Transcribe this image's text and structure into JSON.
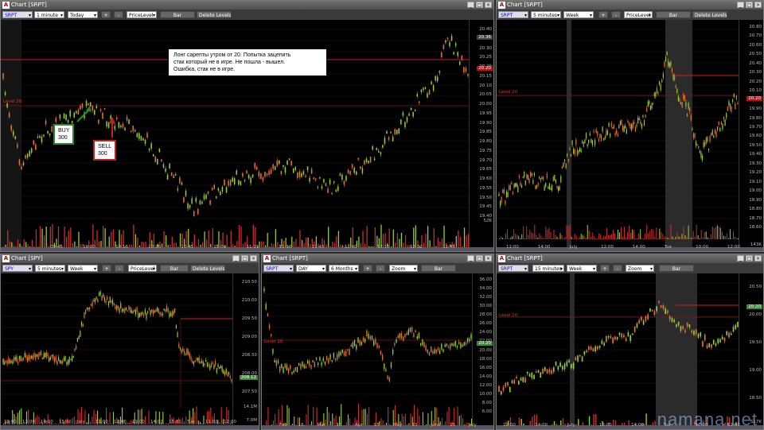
{
  "windows": {
    "w1": {
      "title": "Chart [SRPT]",
      "symbol": "SRPT",
      "interval": "1 minute",
      "range": "Today",
      "view": "PriceLevel",
      "bar": "Bar",
      "delete": "Delete Levels",
      "level_label": "Level 20",
      "yticks": [
        "20.40",
        "20.35",
        "20.30",
        "20.25",
        "20.20",
        "20.15",
        "20.10",
        "20.05",
        "20.00",
        "19.95",
        "19.90",
        "19.85",
        "19.80",
        "19.75",
        "19.70",
        "19.65",
        "19.60",
        "19.55",
        "19.50",
        "19.45",
        "19.40"
      ],
      "tag_top": "20.36",
      "tag_red": "20.20",
      "vol": "52K",
      "xticks": [
        "09:45",
        "10:00",
        "10:15",
        "10:30",
        "10:45",
        "11:00",
        "11:15",
        "11:30",
        "11:45",
        "12:00",
        "12:15",
        "12:32",
        "12:45"
      ],
      "note": "Лонг сарепты утром от 20. Попытка зацепить\nстак который не в игре. Не пошла - вышел.\nОшибка, стак не в игре.",
      "buy": "BUY\n300",
      "sell": "SELL\n300"
    },
    "w2": {
      "title": "Chart [SRPT]",
      "symbol": "SRPT",
      "interval": "5 minutes",
      "range": "Week",
      "view": "PriceLevel",
      "bar": "Bar",
      "delete": "Delete Levels",
      "level_label": "Level 20",
      "yticks": [
        "20.80",
        "20.70",
        "20.60",
        "20.50",
        "20.40",
        "20.30",
        "20.20",
        "20.10",
        "20.00",
        "19.90",
        "19.80",
        "19.70",
        "19.60",
        "19.50",
        "19.40",
        "19.30",
        "19.20",
        "19.10",
        "19.00",
        "18.90",
        "18.80",
        "18.70",
        "18.60"
      ],
      "tag_top": "20.20",
      "vol": "143K",
      "xticks": [
        "12:00",
        "14:00",
        "July",
        "12:00",
        "14:00",
        "Tue",
        "10:00",
        "12:00"
      ]
    },
    "w3": {
      "title": "Chart [SPY]",
      "symbol": "SPY",
      "interval": "5 minutes",
      "range": "Week",
      "view": "PriceLevel",
      "bar": "Bar",
      "delete": "Delete Levels",
      "level_label": "Level 207.91",
      "yticks": [
        "210.50",
        "210.00",
        "209.50",
        "209.00",
        "208.50",
        "208.00",
        "207.50"
      ],
      "tag_top": "208.12",
      "vol_top": "14.1M",
      "vol_mid": "7.0M",
      "xticks": [
        "12:00",
        "13:00",
        "14:00",
        "15:00",
        "July",
        "11:00",
        "12:00",
        "13:00",
        "14:00",
        "15:00",
        "Tue",
        "11:00",
        "12:00"
      ]
    },
    "w4": {
      "title": "Chart [SRPT]",
      "symbol": "SRPT",
      "interval": "DAY",
      "range": "6 Months",
      "view": "Zoom",
      "bar": "Bar",
      "level_label": "Level 20",
      "yticks": [
        "36.00",
        "34.00",
        "32.00",
        "30.00",
        "28.00",
        "26.00",
        "24.00",
        "22.00",
        "20.00",
        "18.00",
        "16.00",
        "14.00",
        "12.00",
        "10.00",
        "8.00",
        "6.00"
      ],
      "tag_top": "20.20",
      "xticks": [
        "Feb",
        "16",
        "Mar",
        "15",
        "Apr",
        "15",
        "May",
        "15",
        "June",
        "15",
        "July"
      ]
    },
    "w5": {
      "title": "Chart [SRPT]",
      "symbol": "SRPT",
      "interval": "15 minutes",
      "range": "Week",
      "view": "Zoom",
      "bar": "Bar",
      "level_label": "Level 20",
      "yticks": [
        "20.50",
        "20.00",
        "19.50",
        "19.00",
        "18.50"
      ],
      "tag_top": "20.20",
      "vol": "517K",
      "xticks": [
        "12:00",
        "14:00",
        "July",
        "12:00",
        "14:00",
        "Tue",
        "10:00",
        "12:00"
      ]
    }
  },
  "watermark": "namana.net",
  "colors": {
    "up": "#9acd32",
    "down": "#e8742a",
    "level": "#d02020",
    "volume": "#c83030"
  }
}
